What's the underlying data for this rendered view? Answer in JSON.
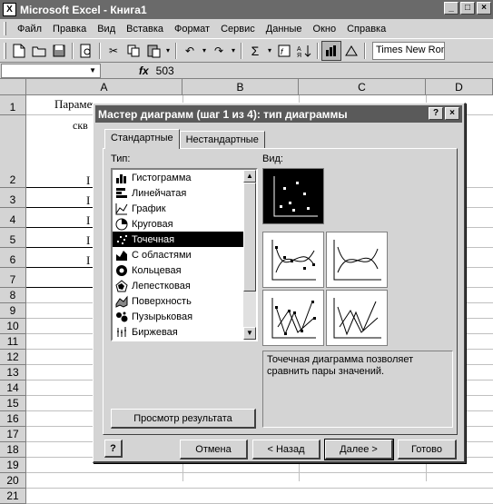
{
  "window": {
    "title": "Microsoft Excel - Книга1"
  },
  "menu": [
    "Файл",
    "Правка",
    "Вид",
    "Вставка",
    "Формат",
    "Сервис",
    "Данные",
    "Окно",
    "Справка"
  ],
  "toolbar": {
    "font_name": "Times New Rom"
  },
  "formula": {
    "name_box": "",
    "fx": "fx",
    "value": "503"
  },
  "columns": [
    "A",
    "B",
    "C",
    "D"
  ],
  "rows": [
    "1",
    "2",
    "3",
    "4",
    "5",
    "6",
    "7",
    "8",
    "9",
    "10",
    "11",
    "12",
    "13",
    "14",
    "15",
    "16",
    "17",
    "18",
    "19",
    "20",
    "21"
  ],
  "cells": {
    "a1": "Парамет",
    "a2": "скв",
    "a3": "I",
    "a4": "I",
    "a5": "I",
    "a6": "I",
    "a7": "I"
  },
  "dialog": {
    "title": "Мастер диаграмм (шаг 1 из 4): тип диаграммы",
    "help_btn": "?",
    "close_btn": "×",
    "tabs": [
      "Стандартные",
      "Нестандартные"
    ],
    "type_label": "Тип:",
    "view_label": "Вид:",
    "types": [
      {
        "label": "Гистограмма",
        "icon": "bar-chart-icon"
      },
      {
        "label": "Линейчатая",
        "icon": "horizontal-bar-icon"
      },
      {
        "label": "График",
        "icon": "line-chart-icon"
      },
      {
        "label": "Круговая",
        "icon": "pie-chart-icon"
      },
      {
        "label": "Точечная",
        "icon": "scatter-chart-icon",
        "selected": true
      },
      {
        "label": "С областями",
        "icon": "area-chart-icon"
      },
      {
        "label": "Кольцевая",
        "icon": "doughnut-chart-icon"
      },
      {
        "label": "Лепестковая",
        "icon": "radar-chart-icon"
      },
      {
        "label": "Поверхность",
        "icon": "surface-chart-icon"
      },
      {
        "label": "Пузырьковая",
        "icon": "bubble-chart-icon"
      },
      {
        "label": "Биржевая",
        "icon": "stock-chart-icon"
      }
    ],
    "description": "Точечная диаграмма позволяет сравнить пары значений.",
    "preview_btn": "Просмотр результата",
    "cancel_btn": "Отмена",
    "back_btn": "< Назад",
    "next_btn": "Далее >",
    "finish_btn": "Готово",
    "help_icon_btn": "?"
  }
}
